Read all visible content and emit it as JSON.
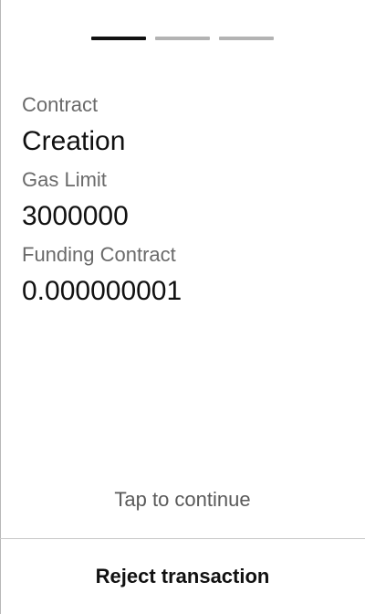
{
  "pager": {
    "total_steps": 3,
    "current_step": 1
  },
  "details": [
    {
      "label": "Contract",
      "value": "Creation"
    },
    {
      "label": "Gas Limit",
      "value": "3000000"
    },
    {
      "label": "Funding Contract",
      "value": "0.000000001"
    }
  ],
  "footer": {
    "hint": "Tap to continue",
    "reject_label": "Reject transaction"
  },
  "colors": {
    "pager_active": "#111111",
    "pager_inactive": "#b3b3b3",
    "label_text": "#6a6a6a",
    "value_text": "#111111"
  }
}
